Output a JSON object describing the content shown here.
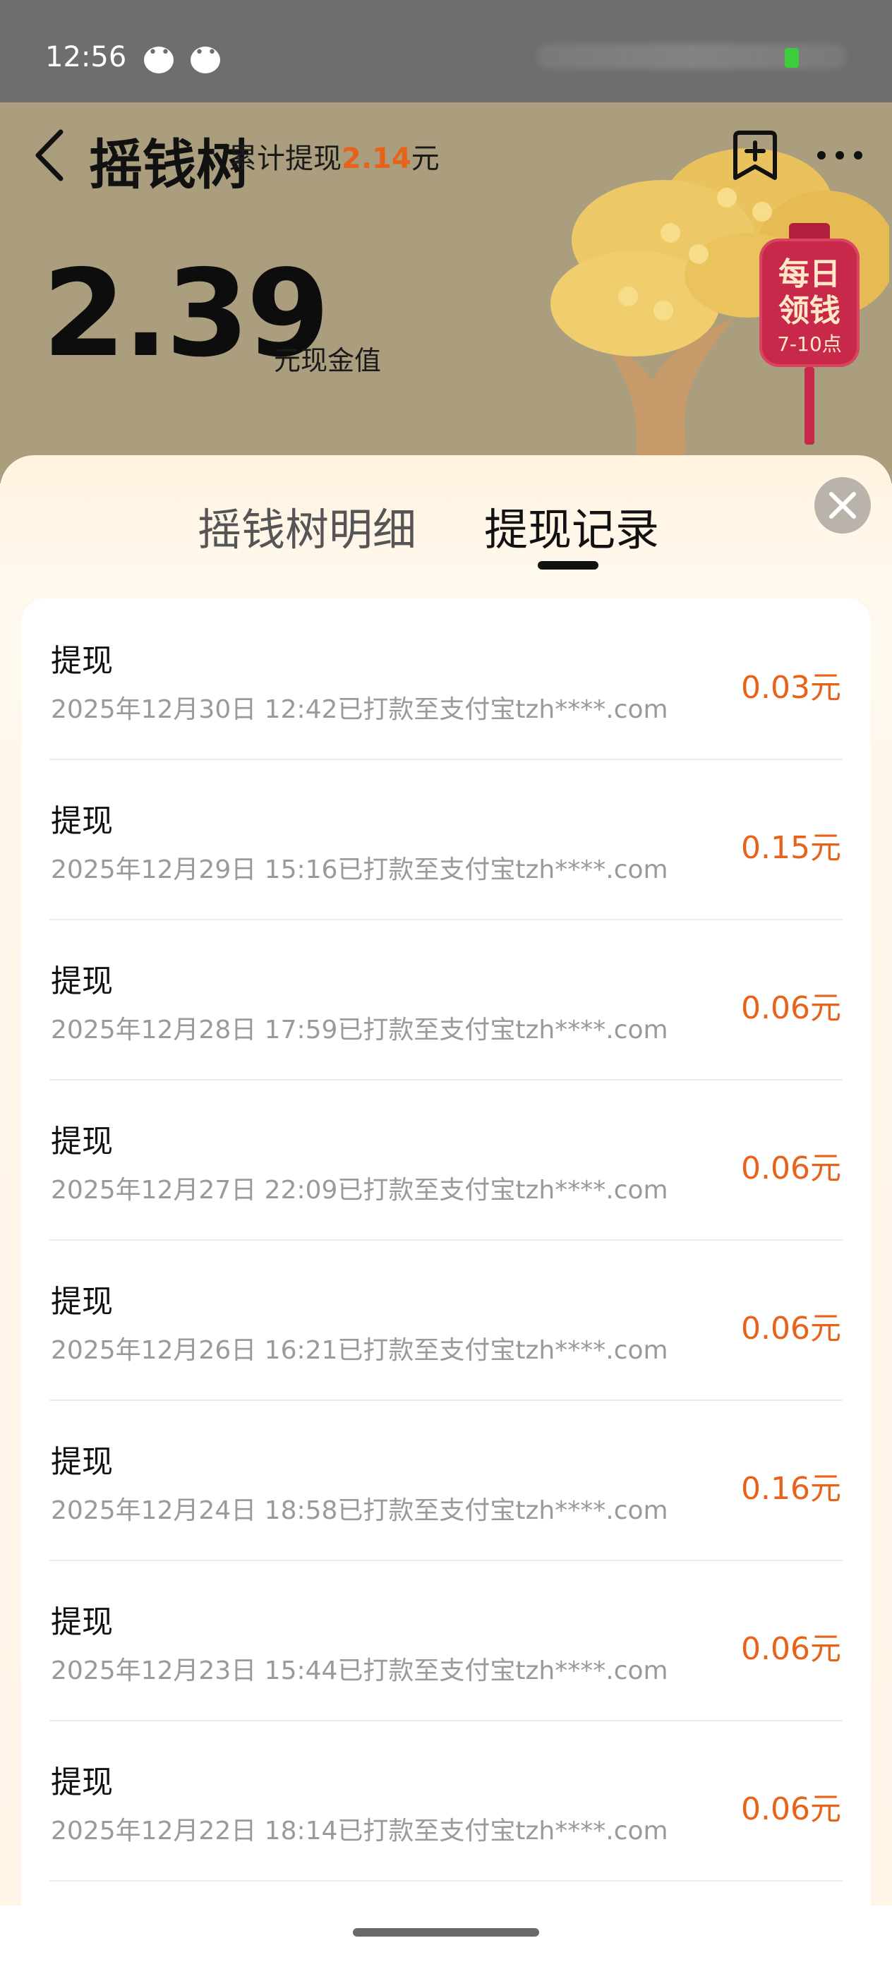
{
  "status_bar": {
    "time": "12:56"
  },
  "header": {
    "title": "摇钱树",
    "cumulative_prefix": "累计提现",
    "cumulative_amount": "2.14",
    "cumulative_unit": "元",
    "balance": "2.39",
    "balance_unit": "元现金值"
  },
  "lantern": {
    "line1": "每日",
    "line2": "领钱",
    "line3": "7-10点"
  },
  "tabs": [
    {
      "label": "摇钱树明细",
      "active": false
    },
    {
      "label": "提现记录",
      "active": true
    }
  ],
  "records": [
    {
      "title": "提现",
      "desc": "2025年12月30日 12:42已打款至支付宝tzh****.com",
      "amount": "0.03元"
    },
    {
      "title": "提现",
      "desc": "2025年12月29日 15:16已打款至支付宝tzh****.com",
      "amount": "0.15元"
    },
    {
      "title": "提现",
      "desc": "2025年12月28日 17:59已打款至支付宝tzh****.com",
      "amount": "0.06元"
    },
    {
      "title": "提现",
      "desc": "2025年12月27日 22:09已打款至支付宝tzh****.com",
      "amount": "0.06元"
    },
    {
      "title": "提现",
      "desc": "2025年12月26日 16:21已打款至支付宝tzh****.com",
      "amount": "0.06元"
    },
    {
      "title": "提现",
      "desc": "2025年12月24日 18:58已打款至支付宝tzh****.com",
      "amount": "0.16元"
    },
    {
      "title": "提现",
      "desc": "2025年12月23日 15:44已打款至支付宝tzh****.com",
      "amount": "0.06元"
    },
    {
      "title": "提现",
      "desc": "2025年12月22日 18:14已打款至支付宝tzh****.com",
      "amount": "0.06元"
    }
  ],
  "colors": {
    "accent": "#e8621a",
    "header_bg": "#aa9e7e",
    "lantern": "#c8284a"
  },
  "icons": [
    "back-arrow-icon",
    "bookmark-add-icon",
    "more-icon",
    "close-icon",
    "chat-bubble-icon"
  ]
}
